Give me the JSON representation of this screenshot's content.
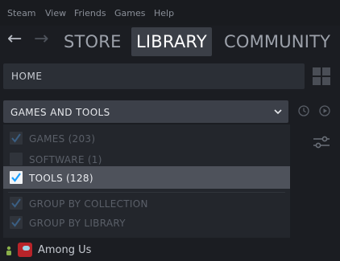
{
  "menubar": {
    "items": [
      "Steam",
      "View",
      "Friends",
      "Games",
      "Help"
    ]
  },
  "nav": {
    "back_icon": "arrow-left-icon",
    "forward_icon": "arrow-right-icon",
    "store": "STORE",
    "library": "LIBRARY",
    "community": "COMMUNITY"
  },
  "home": {
    "label": "HOME"
  },
  "filter": {
    "selected": "GAMES AND TOOLS",
    "options": [
      {
        "label": "GAMES",
        "count": "(203)",
        "checked": true,
        "selected": false
      },
      {
        "label": "SOFTWARE",
        "count": "(1)",
        "checked": false,
        "selected": false
      },
      {
        "label": "TOOLS",
        "count": "(128)",
        "checked": true,
        "selected": true
      },
      {
        "label": "GROUP BY COLLECTION",
        "count": "",
        "checked": true,
        "selected": false
      },
      {
        "label": "GROUP BY LIBRARY",
        "count": "",
        "checked": true,
        "selected": false
      }
    ]
  },
  "game": {
    "name": "Among Us"
  },
  "colors": {
    "accent_check": "#1a9fff",
    "active_tab_bg": "#3b3f47"
  }
}
